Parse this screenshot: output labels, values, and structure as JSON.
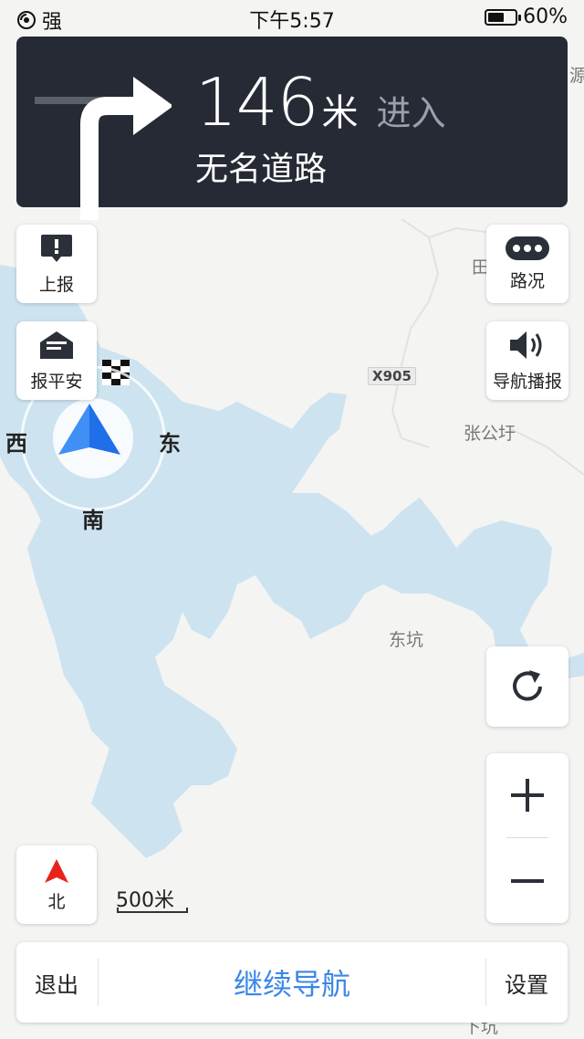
{
  "status_bar": {
    "signal": "强",
    "time": "下午5:57",
    "battery": "60%",
    "battery_level": 0.6
  },
  "guidance": {
    "distance": "146",
    "unit": "米",
    "action": "进入",
    "road_name": "无名道路",
    "maneuver_icon": "turn-right-icon"
  },
  "buttons": {
    "report": "上报",
    "safe": "报平安",
    "traffic": "路况",
    "voice": "导航播报",
    "north": "北"
  },
  "compass": {
    "west": "西",
    "east": "东",
    "south": "南"
  },
  "map": {
    "places": {
      "zhanggongxu": "张公圩",
      "dongkeng": "东坑",
      "tian": "田",
      "yuan": "源",
      "xiakeng": "下坑"
    },
    "road_label": "X905",
    "scale": "500米",
    "water_color": "#cde3f0",
    "land_color": "#f4f4f2"
  },
  "bottom_bar": {
    "exit": "退出",
    "continue": "继续导航",
    "settings": "设置"
  }
}
